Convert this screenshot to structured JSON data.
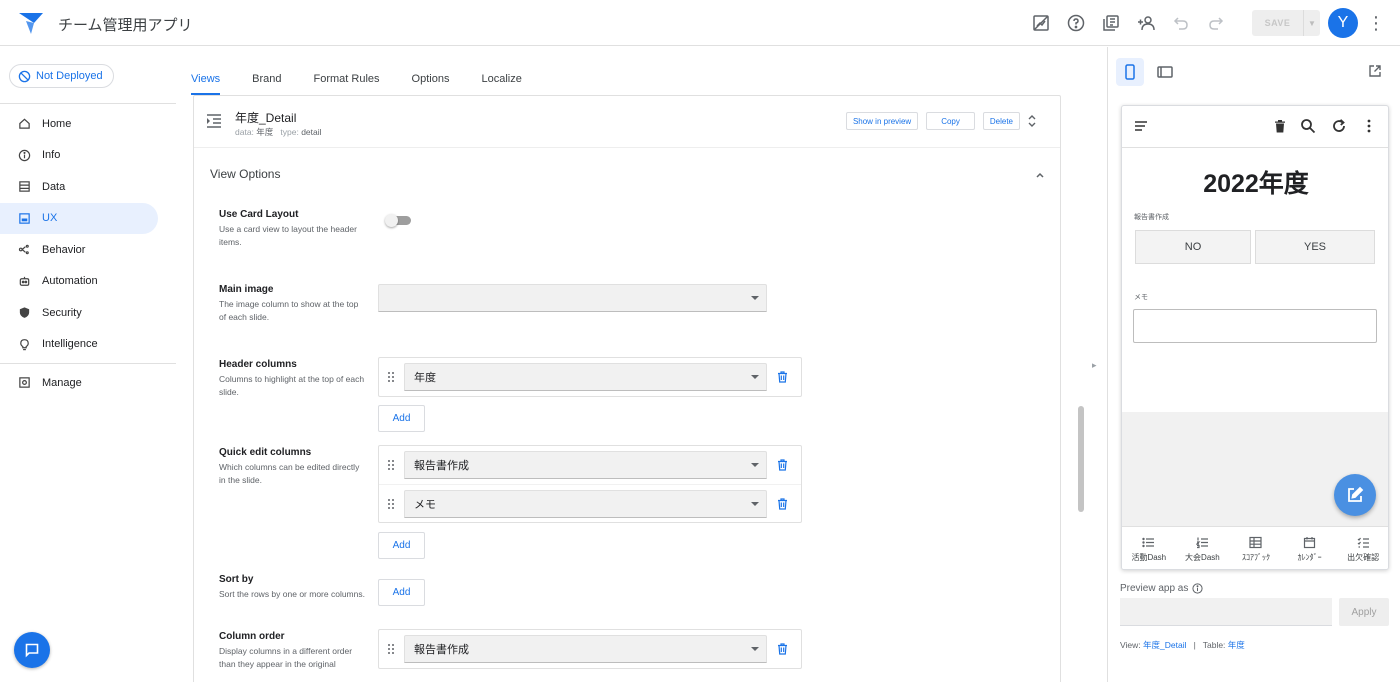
{
  "header": {
    "app_title": "チーム管理用アプリ",
    "save_label": "SAVE",
    "avatar_initial": "Y"
  },
  "sidebar": {
    "deploy_status": "Not Deployed",
    "items": [
      {
        "label": "Home",
        "icon": "home-icon"
      },
      {
        "label": "Info",
        "icon": "info-icon"
      },
      {
        "label": "Data",
        "icon": "data-icon"
      },
      {
        "label": "UX",
        "icon": "ux-icon",
        "active": true
      },
      {
        "label": "Behavior",
        "icon": "behavior-icon"
      },
      {
        "label": "Automation",
        "icon": "automation-icon"
      },
      {
        "label": "Security",
        "icon": "shield-icon"
      },
      {
        "label": "Intelligence",
        "icon": "lightbulb-icon"
      }
    ],
    "manage_label": "Manage"
  },
  "tabs": [
    "Views",
    "Brand",
    "Format Rules",
    "Options",
    "Localize"
  ],
  "view": {
    "title": "年度_Detail",
    "data_label": "data:",
    "data_value": "年度",
    "type_label": "type:",
    "type_value": "detail",
    "show_preview_label": "Show in preview",
    "copy_label": "Copy",
    "delete_label": "Delete"
  },
  "options": {
    "section_title": "View Options",
    "use_card": {
      "label": "Use Card Layout",
      "desc": "Use a card view to layout the header items.",
      "on": false
    },
    "main_image": {
      "label": "Main image",
      "desc": "The image column to show at the top of each slide.",
      "value": ""
    },
    "header_columns": {
      "label": "Header columns",
      "desc": "Columns to highlight at the top of each slide.",
      "values": [
        "年度"
      ]
    },
    "quick_edit": {
      "label": "Quick edit columns",
      "desc": "Which columns can be edited directly in the slide.",
      "values": [
        "報告書作成",
        "メモ"
      ]
    },
    "sort_by": {
      "label": "Sort by",
      "desc": "Sort the rows by one or more columns."
    },
    "column_order": {
      "label": "Column order",
      "desc": "Display columns in a different order than they appear in the original",
      "values": [
        "報告書作成"
      ]
    },
    "add_label": "Add"
  },
  "preview": {
    "record_title": "2022年度",
    "field1_label": "報告書作成",
    "no_label": "NO",
    "yes_label": "YES",
    "field2_label": "メモ",
    "nav": [
      {
        "label": "活動Dash",
        "icon": "list-icon"
      },
      {
        "label": "大会Dash",
        "icon": "numbered-list-icon"
      },
      {
        "label": "ｽｺｱﾌﾞｯｸ",
        "icon": "table-icon"
      },
      {
        "label": "ｶﾚﾝﾀﾞｰ",
        "icon": "calendar-icon"
      },
      {
        "label": "出欠確認",
        "icon": "checklist-icon"
      }
    ],
    "preview_as_label": "Preview app as",
    "apply_label": "Apply",
    "view_label": "View:",
    "view_value": "年度_Detail",
    "table_label": "Table:",
    "table_value": "年度",
    "separator": "|"
  },
  "colors": {
    "accent": "#1a73e8",
    "fab": "#4a90e2"
  }
}
